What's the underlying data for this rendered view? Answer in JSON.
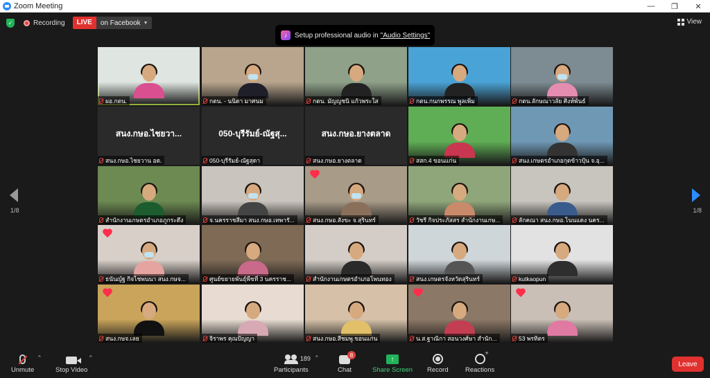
{
  "window": {
    "title": "Zoom Meeting",
    "minimize": "—",
    "maximize": "❐",
    "close": "✕"
  },
  "topbar": {
    "recording_label": "Recording",
    "live_badge": "LIVE",
    "live_target": "on Facebook",
    "view_label": "View"
  },
  "toast": {
    "text": "Setup professional audio in",
    "link": "\"Audio Settings\""
  },
  "pager": {
    "left": "1/8",
    "right": "1/8"
  },
  "tiles": [
    {
      "name": "ผอ.กตน.",
      "type": "video",
      "active": true,
      "heart": false,
      "bg": "#dfe5e0",
      "shirt": "#d94f8f",
      "mask": false
    },
    {
      "name": "กตน. - นนิดา มาศนม",
      "type": "video",
      "active": false,
      "heart": false,
      "bg": "#b9a58d",
      "shirt": "#1f1f2a",
      "mask": true
    },
    {
      "name": "กตน. มัญญชนิ แก้วพระใส",
      "type": "video",
      "active": false,
      "heart": false,
      "bg": "#8fa189",
      "shirt": "#222",
      "mask": false
    },
    {
      "name": "กตน.กนกพรรณ พูลเพิ่ม",
      "type": "video",
      "active": false,
      "heart": false,
      "bg": "#4aa3d6",
      "shirt": "#222",
      "mask": false
    },
    {
      "name": "กตน.ลักษณาวลัย ศิงห์พันธ์",
      "type": "video",
      "active": false,
      "heart": false,
      "bg": "#7d8b92",
      "shirt": "#e48db0",
      "mask": true
    },
    {
      "name": "สนง.กษอ.ไชยวาน อด.",
      "type": "text",
      "bigname": "สนง.กษอ.ไชยวา...",
      "active": false,
      "heart": false
    },
    {
      "name": "050-บุรีรัมย์-ณัฐสุดา",
      "type": "text",
      "bigname": "050-บุรีรัมย์-ณัฐสุ...",
      "active": false,
      "heart": false
    },
    {
      "name": "สนง.กษอ.ยางตลาด",
      "type": "text",
      "bigname": "สนง.กษอ.ยางตลาด",
      "active": false,
      "heart": false
    },
    {
      "name": "สสก.4 ขอนแก่น",
      "type": "video",
      "active": false,
      "heart": false,
      "bg": "#5fae55",
      "shirt": "#c9364f",
      "mask": false
    },
    {
      "name": "สนง.เกษตรอำเภอกุดข้าวปุ้น จ.อุ...",
      "type": "video",
      "active": false,
      "heart": false,
      "bg": "#6f98b5",
      "shirt": "#333",
      "mask": false
    },
    {
      "name": "สำนักงานเกษตรอำเภอภูกระดึง",
      "type": "video",
      "active": false,
      "heart": false,
      "bg": "#6c8a52",
      "shirt": "#1c5c2e",
      "mask": false
    },
    {
      "name": "จ.นครราชสีมา สนง.กษอ.เทพารั...",
      "type": "video",
      "active": false,
      "heart": false,
      "bg": "#c9c4bd",
      "shirt": "#444",
      "mask": true
    },
    {
      "name": "สนง.กษอ.สังขะ จ.สุรินทร์",
      "type": "video",
      "active": false,
      "heart": true,
      "bg": "#a89b88",
      "shirt": "#8a6f5b",
      "mask": true
    },
    {
      "name": "วัชรี กิจประภัสสร สำนักงานเกษ...",
      "type": "video",
      "active": false,
      "heart": false,
      "bg": "#8fa67a",
      "shirt": "#c98a6a",
      "mask": false
    },
    {
      "name": "ลักคณา สนง.กษอ.โนนแดง นคร...",
      "type": "video",
      "active": false,
      "heart": false,
      "bg": "#c8c5bf",
      "shirt": "#3a5c8c",
      "mask": false
    },
    {
      "name": "ธนันญ์ฐ กิจไชพนนา สนง.กษจ...",
      "type": "video",
      "active": false,
      "heart": true,
      "bg": "#d8cfc8",
      "shirt": "#e5a4a0",
      "mask": true
    },
    {
      "name": "ศูนย์ขยายพันธุ์พืชที่ 3 นครราช...",
      "type": "video",
      "active": false,
      "heart": false,
      "bg": "#7e6a55",
      "shirt": "#c96a8a",
      "mask": false
    },
    {
      "name": "สำนักงานเกษตรอำเภอโพนทอง",
      "type": "video",
      "active": false,
      "heart": false,
      "bg": "#d4cdc7",
      "shirt": "#2a2a2a",
      "mask": false
    },
    {
      "name": "สนง.เกษตรจังหวัดสุรินทร์",
      "type": "video",
      "active": false,
      "heart": false,
      "bg": "#cfd6da",
      "shirt": "#555",
      "mask": false
    },
    {
      "name": "kutkaopun",
      "type": "video",
      "active": false,
      "heart": false,
      "bg": "#e2e2e2",
      "shirt": "#2e2e2e",
      "mask": false
    },
    {
      "name": "สนง.กษจ.เลย",
      "type": "video",
      "active": false,
      "heart": true,
      "bg": "#c9a45a",
      "shirt": "#111",
      "mask": false
    },
    {
      "name": "จิราพร คุณปัญญา",
      "type": "video",
      "active": false,
      "heart": false,
      "bg": "#e8dcd2",
      "shirt": "#d7a9b5",
      "mask": false
    },
    {
      "name": "สนง.กษอ.สีชมพู.ขอนแก่น",
      "type": "video",
      "active": false,
      "heart": false,
      "bg": "#d6c1a8",
      "shirt": "#e2c06a",
      "mask": false
    },
    {
      "name": "น.ส.ฐาณิกา สอนวงศ์ษา สำนัก...",
      "type": "video",
      "active": false,
      "heart": true,
      "bg": "#8c7866",
      "shirt": "#c43e52",
      "mask": false
    },
    {
      "name": "53 พรทิตร",
      "type": "video",
      "active": false,
      "heart": true,
      "bg": "#c9bfb6",
      "shirt": "#e07aa2",
      "mask": false
    }
  ],
  "toolbar": {
    "unmute": "Unmute",
    "stop_video": "Stop Video",
    "participants": "Participants",
    "participants_count": "189",
    "chat": "Chat",
    "chat_badge": "8",
    "share_screen": "Share Screen",
    "record": "Record",
    "reactions": "Reactions",
    "leave": "Leave"
  },
  "colors": {
    "accent": "#2d8cff",
    "live": "#e0312f",
    "active_speaker": "#c5e84c",
    "share": "#22b25a"
  }
}
